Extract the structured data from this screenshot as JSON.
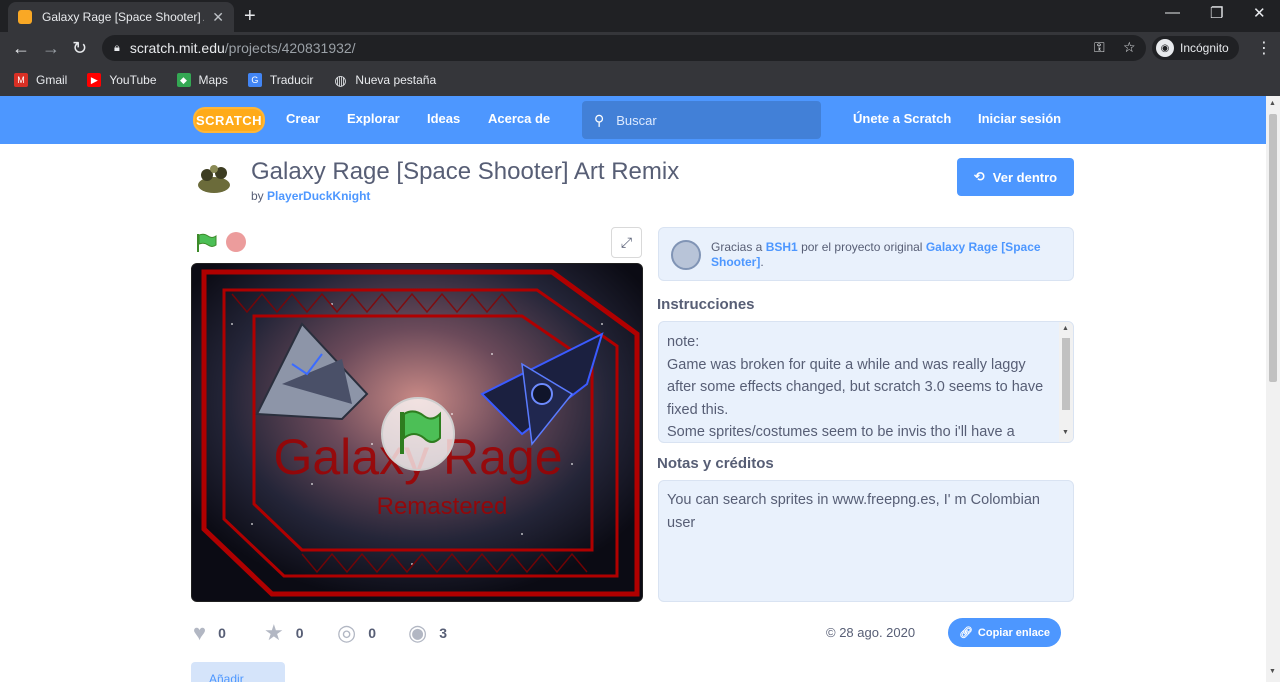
{
  "browser": {
    "tab_title": "Galaxy Rage [Space Shooter] Art",
    "url_host": "scratch.mit.edu",
    "url_path": "/projects/420831932/",
    "incognito_label": "Incógnito",
    "bookmarks": [
      {
        "label": "Gmail",
        "icon": "gmail-icon",
        "color": "#d93025"
      },
      {
        "label": "YouTube",
        "icon": "youtube-icon",
        "color": "#ff0000"
      },
      {
        "label": "Maps",
        "icon": "maps-icon",
        "color": "#34a853"
      },
      {
        "label": "Traducir",
        "icon": "translate-icon",
        "color": "#4285f4"
      },
      {
        "label": "Nueva pestaña",
        "icon": "globe-icon",
        "color": "#e8eaed"
      }
    ]
  },
  "scratch_nav": {
    "logo": "SCRATCH",
    "links": [
      "Crear",
      "Explorar",
      "Ideas",
      "Acerca de"
    ],
    "search_placeholder": "Buscar",
    "join": "Únete a Scratch",
    "signin": "Iniciar sesión",
    "accent": "#4d97ff"
  },
  "project": {
    "title": "Galaxy Rage [Space Shooter] Art Remix",
    "by_prefix": "by",
    "author": "PlayerDuckKnight",
    "see_inside": "Ver dentro",
    "stage_title": "Galaxy Rage",
    "stage_subtitle": "Remastered",
    "credit": {
      "prefix": "Gracias a",
      "user": "BSH1",
      "middle": "por el proyecto original",
      "original": "Galaxy Rage [Space Shooter]",
      "suffix": "."
    },
    "instructions_title": "Instrucciones",
    "instructions_text": "note:\nGame was broken for quite a while and was really laggy after some effects changed, but scratch 3.0 seems to have fixed this.\nSome sprites/costumes seem to be invis tho i'll have a",
    "notes_title": "Notas y créditos",
    "notes_text": "You can search sprites in www.freepng.es, I' m Colombian user",
    "stats": {
      "loves": "0",
      "favorites": "0",
      "remixes": "0",
      "views": "3"
    },
    "date": "© 28 ago. 2020",
    "copy_link": "Copiar enlace",
    "studio_button": "Añadir"
  }
}
